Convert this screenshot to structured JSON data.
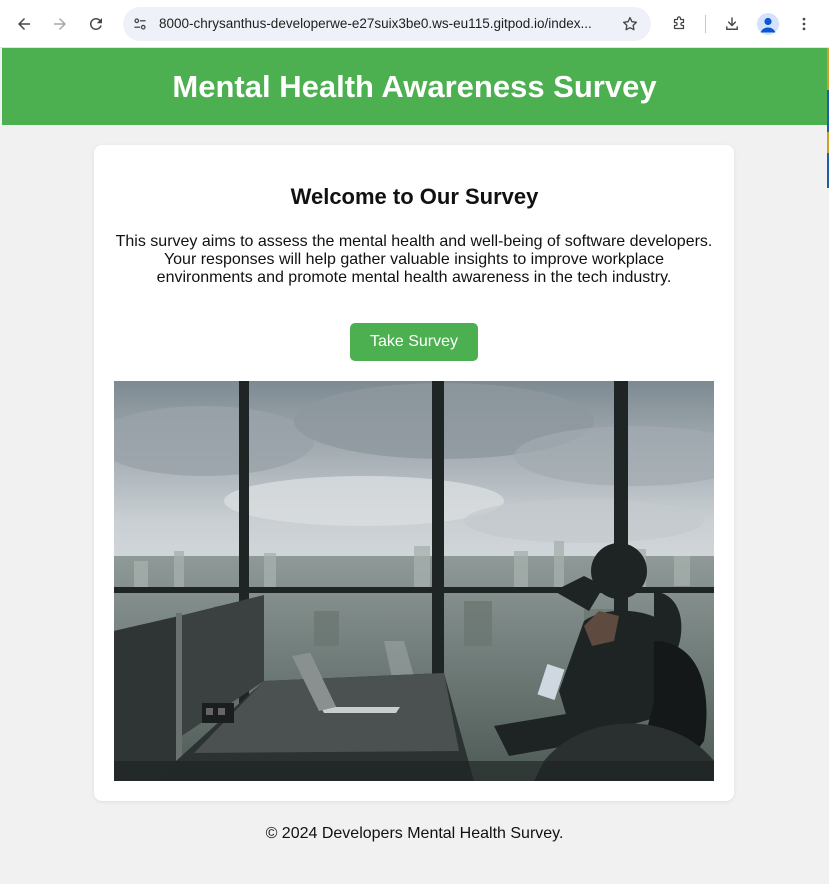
{
  "browser": {
    "url": "8000-chrysanthus-developerwe-e27suix3be0.ws-eu115.gitpod.io/index...",
    "back_icon": "arrow-left-icon",
    "forward_icon": "arrow-right-icon",
    "reload_icon": "reload-icon",
    "site_info_icon": "tune-icon",
    "bookmark_icon": "star-icon",
    "extensions_icon": "puzzle-icon",
    "download_icon": "download-icon",
    "profile_icon": "person-icon",
    "menu_icon": "kebab-menu-icon"
  },
  "header": {
    "title": "Mental Health Awareness Survey",
    "background": "#4caf50"
  },
  "main": {
    "heading": "Welcome to Our Survey",
    "intro_lines": [
      "This survey aims to assess the mental health and well-being of software developers.",
      "Your responses will help gather valuable insights to improve workplace",
      "environments and promote mental health awareness in the tech industry."
    ],
    "cta_label": "Take Survey",
    "accent": "#4caf50"
  },
  "footer": {
    "text": "© 2024 Developers Mental Health Survey."
  }
}
